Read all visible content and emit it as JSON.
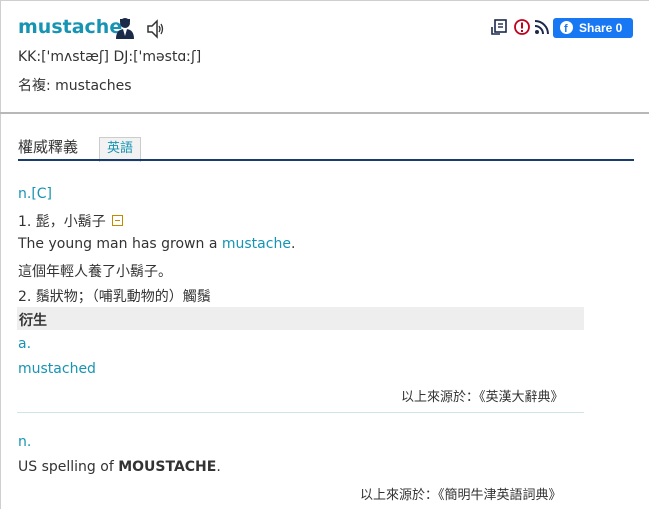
{
  "header": {
    "word": "mustache",
    "phonetic": "KK:['mʌstæʃ] DJ:['məstɑːʃ]",
    "plural": "名複: mustaches",
    "share_label": "Share 0",
    "share_icon": "f"
  },
  "tabs": {
    "title": "權威釋義",
    "active": "英語"
  },
  "entry1": {
    "pos": "n.[C]",
    "sense1": "1. 髭，小鬍子",
    "example_prefix": "The young man has grown a ",
    "example_link": "mustache",
    "example_suffix": ".",
    "example_zh": "這個年輕人養了小鬍子。",
    "sense2": "2. 鬚狀物；（哺乳動物的）觸鬚",
    "deriv_label": "衍生",
    "deriv_pos": "a.",
    "deriv_word": "mustached",
    "source": "以上來源於：《英漢大辭典》"
  },
  "entry2": {
    "pos": "n.",
    "text_prefix": "US spelling of ",
    "text_bold": "MOUSTACHE",
    "text_suffix": ".",
    "source": "以上來源於：《簡明牛津英語詞典》"
  },
  "colors": {
    "accent": "#1794b3",
    "tab_underline": "#1a3b6e",
    "facebook": "#1877f2"
  },
  "icons": [
    "person-icon",
    "speaker-icon",
    "note-icon",
    "report-icon",
    "rss-icon",
    "facebook-icon",
    "fold-icon"
  ]
}
